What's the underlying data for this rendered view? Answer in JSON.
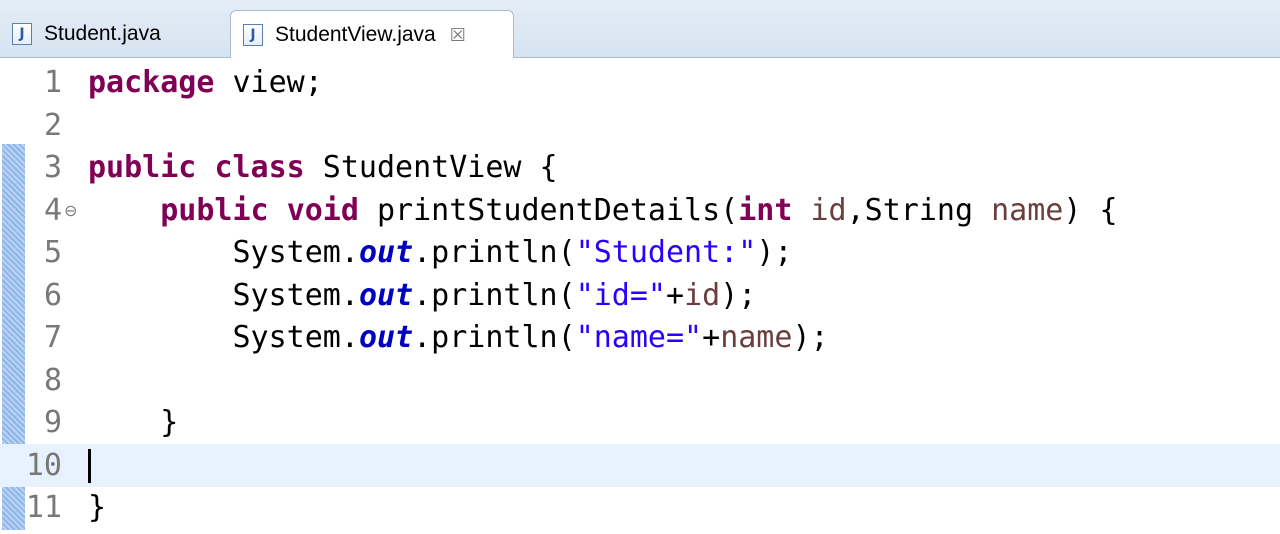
{
  "tabs": [
    {
      "label": "Student.java",
      "icon": "java-file-icon",
      "active": false
    },
    {
      "label": "StudentView.java",
      "icon": "java-file-icon",
      "active": true,
      "close": "☒"
    }
  ],
  "editor": {
    "lines": [
      {
        "num": "1",
        "tokens": [
          {
            "t": "package",
            "c": "kw"
          },
          {
            "t": " view;",
            "c": ""
          }
        ]
      },
      {
        "num": "2",
        "tokens": []
      },
      {
        "num": "3",
        "tokens": [
          {
            "t": "public",
            "c": "kw"
          },
          {
            "t": " ",
            "c": ""
          },
          {
            "t": "class",
            "c": "kw"
          },
          {
            "t": " StudentView {",
            "c": ""
          }
        ]
      },
      {
        "num": "4",
        "fold": "⊖",
        "tokens": [
          {
            "t": "    ",
            "c": ""
          },
          {
            "t": "public",
            "c": "kw"
          },
          {
            "t": " ",
            "c": ""
          },
          {
            "t": "void",
            "c": "kw"
          },
          {
            "t": " printStudentDetails(",
            "c": ""
          },
          {
            "t": "int",
            "c": "kw"
          },
          {
            "t": " ",
            "c": ""
          },
          {
            "t": "id",
            "c": "var"
          },
          {
            "t": ",String ",
            "c": ""
          },
          {
            "t": "name",
            "c": "var"
          },
          {
            "t": ") {",
            "c": ""
          }
        ]
      },
      {
        "num": "5",
        "tokens": [
          {
            "t": "        System.",
            "c": ""
          },
          {
            "t": "out",
            "c": "fld"
          },
          {
            "t": ".println(",
            "c": ""
          },
          {
            "t": "\"Student:\"",
            "c": "str"
          },
          {
            "t": ");",
            "c": ""
          }
        ]
      },
      {
        "num": "6",
        "tokens": [
          {
            "t": "        System.",
            "c": ""
          },
          {
            "t": "out",
            "c": "fld"
          },
          {
            "t": ".println(",
            "c": ""
          },
          {
            "t": "\"id=\"",
            "c": "str"
          },
          {
            "t": "+",
            "c": ""
          },
          {
            "t": "id",
            "c": "var"
          },
          {
            "t": ");",
            "c": ""
          }
        ]
      },
      {
        "num": "7",
        "tokens": [
          {
            "t": "        System.",
            "c": ""
          },
          {
            "t": "out",
            "c": "fld"
          },
          {
            "t": ".println(",
            "c": ""
          },
          {
            "t": "\"name=\"",
            "c": "str"
          },
          {
            "t": "+",
            "c": ""
          },
          {
            "t": "name",
            "c": "var"
          },
          {
            "t": ");",
            "c": ""
          }
        ]
      },
      {
        "num": "8",
        "tokens": []
      },
      {
        "num": "9",
        "tokens": [
          {
            "t": "    }",
            "c": ""
          }
        ]
      },
      {
        "num": "10",
        "current": true,
        "tokens": []
      },
      {
        "num": "11",
        "tokens": [
          {
            "t": "}",
            "c": ""
          }
        ]
      }
    ]
  },
  "colors": {
    "keyword": "#7f0055",
    "string": "#2a00ff",
    "field": "#0000c0",
    "variable": "#6a3e3e",
    "line_number": "#787878",
    "current_line": "#e8f2fe"
  }
}
